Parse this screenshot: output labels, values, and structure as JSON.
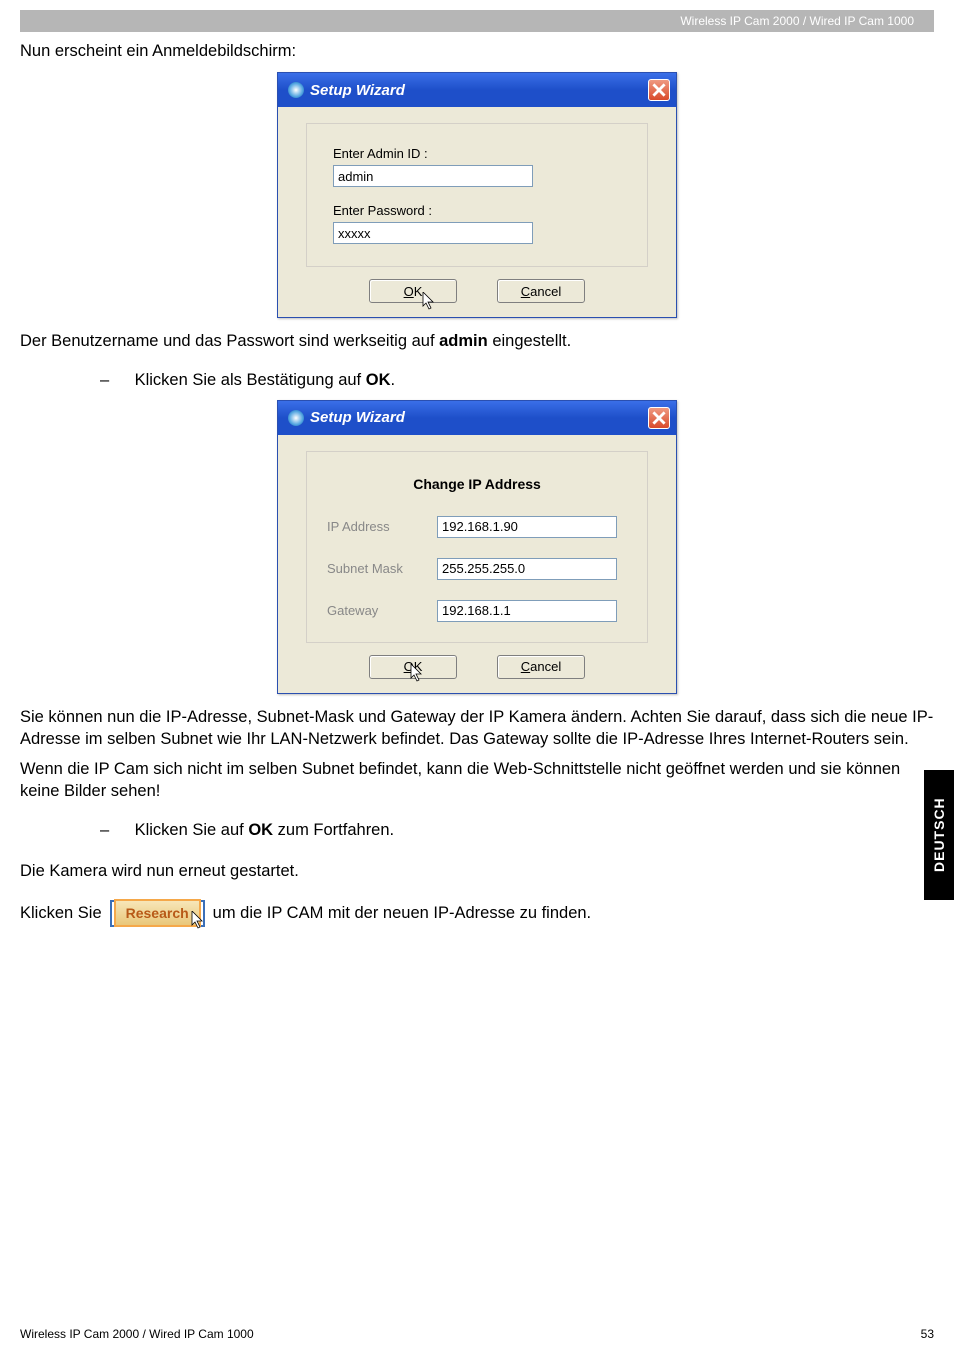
{
  "header": {
    "product": "Wireless IP Cam 2000 / Wired IP Cam 1000"
  },
  "intro": "Nun erscheint ein Anmeldebildschirm:",
  "login_dialog": {
    "title": "Setup Wizard",
    "admin_label": "Enter Admin ID :",
    "admin_value": "admin",
    "pass_label": "Enter Password :",
    "pass_value": "xxxxx",
    "ok_label": "OK",
    "cancel_label": "Cancel"
  },
  "after_login_1": "Der Benutzername und das Passwort sind werkseitig auf ",
  "after_login_bold": "admin",
  "after_login_2": " eingestellt.",
  "bullet1_pre": "Klicken Sie als Bestätigung auf ",
  "bullet1_bold": "OK",
  "bullet1_post": ".",
  "ip_dialog": {
    "title": "Setup Wizard",
    "panel_title": "Change IP Address",
    "ip_label": "IP Address",
    "ip_value": "192.168.1.90",
    "mask_label": "Subnet Mask",
    "mask_value": "255.255.255.0",
    "gw_label": "Gateway",
    "gw_value": "192.168.1.1",
    "ok_label": "OK",
    "cancel_label": "Cancel"
  },
  "para2": "Sie können nun die IP-Adresse, Subnet-Mask und Gateway der IP Kamera ändern. Achten Sie darauf, dass sich die neue IP-Adresse im selben Subnet wie Ihr LAN-Netzwerk befindet. Das Gateway sollte die IP-Adresse Ihres Internet-Routers sein.",
  "para3": "Wenn die IP Cam sich nicht im selben Subnet befindet, kann die Web-Schnittstelle nicht geöffnet werden und sie können keine Bilder sehen!",
  "bullet2_pre": "Klicken Sie auf ",
  "bullet2_bold": "OK",
  "bullet2_post": " zum Fortfahren.",
  "para4": "Die Kamera wird nun erneut gestartet.",
  "research": {
    "pre": "Klicken Sie",
    "btn": "Research",
    "post": "um die IP CAM mit der neuen IP-Adresse zu finden."
  },
  "side_tab": "DEUTSCH",
  "footer": {
    "left": "Wireless IP Cam 2000 / Wired IP Cam 1000",
    "right": "53"
  }
}
